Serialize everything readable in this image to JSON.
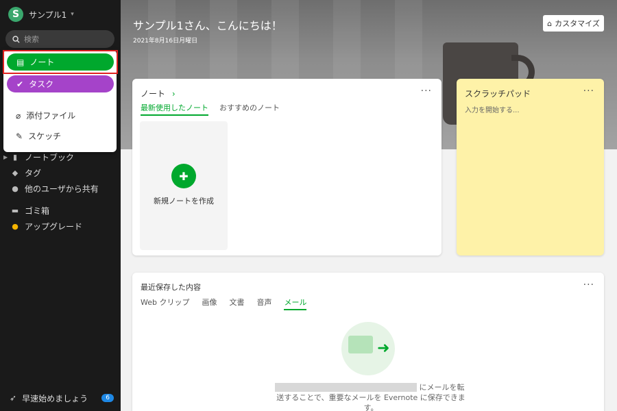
{
  "sidebar": {
    "account_initial": "S",
    "account_name": "サンプル1",
    "search_placeholder": "検索",
    "items": [
      {
        "label": "ノートブック",
        "icon": "notebook-icon"
      },
      {
        "label": "タグ",
        "icon": "tag-icon"
      },
      {
        "label": "他のユーザから共有",
        "icon": "shared-users-icon"
      },
      {
        "label": "ゴミ箱",
        "icon": "trash-icon"
      },
      {
        "label": "アップグレード",
        "icon": "upgrade-icon"
      }
    ],
    "quick_start": "早速始めましょう",
    "quick_start_badge": "6"
  },
  "popup": {
    "note": "ノート",
    "task": "タスク",
    "attachment": "添付ファイル",
    "sketch": "スケッチ"
  },
  "hero": {
    "greeting": "サンプル1さん、こんにちは！",
    "date": "2021年8月16日月曜日",
    "customize": "カスタマイズ"
  },
  "notes_card": {
    "title": "ノート",
    "tab_recent": "最新使用したノート",
    "tab_recommended": "おすすめのノート",
    "new_note": "新規ノートを作成"
  },
  "scratch_card": {
    "title": "スクラッチパッド",
    "placeholder": "入力を開始する..."
  },
  "saved_card": {
    "title": "最近保存した内容",
    "tabs": [
      "Web クリップ",
      "画像",
      "文書",
      "音声",
      "メール"
    ],
    "message": "にメールを転送することで、重要なメールを Evernote に保存できます。"
  },
  "colors": {
    "green": "#00a82d",
    "purple": "#a543c9",
    "sidebar": "#1a1a1a",
    "scratch": "#fef2a8"
  }
}
